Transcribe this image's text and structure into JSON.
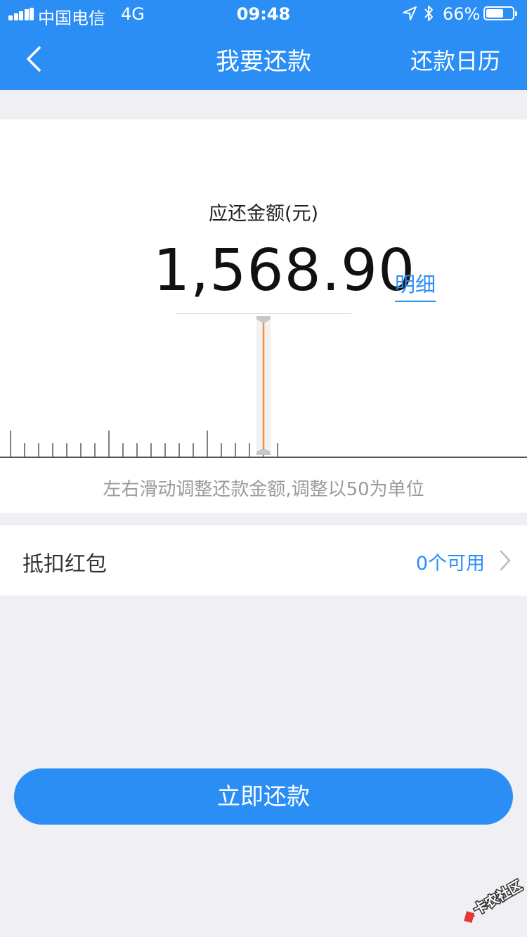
{
  "status_bar": {
    "carrier": "中国电信",
    "network": "4G",
    "time": "09:48",
    "battery_percent": "66%",
    "battery_level": 0.66
  },
  "nav": {
    "title": "我要还款",
    "right_label": "还款日历",
    "back_icon": "chevron-left-icon"
  },
  "amount_card": {
    "label": "应还金额(元)",
    "amount": "1,568.90",
    "detail_link": "明细",
    "slider_hint": "左右滑动调整还款金额,调整以50为单位",
    "accent_color": "#f5913b"
  },
  "coupon": {
    "label": "抵扣红包",
    "value": "0个可用",
    "icon": "chevron-right-icon"
  },
  "pay_button": {
    "label": "立即还款"
  },
  "watermark": {
    "text": "卡农社区"
  },
  "colors": {
    "brand": "#2b8ef5",
    "background": "#efeff4"
  }
}
